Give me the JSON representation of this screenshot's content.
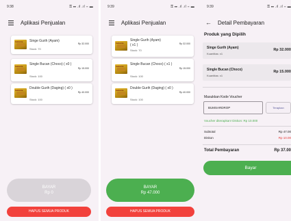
{
  "screens": [
    {
      "status": {
        "time": "9:38",
        "right": "⚿ ☷ .ıl .ıl ⌔ ▬"
      },
      "app_title": "Aplikasi Penjualan",
      "products": [
        {
          "name": "Singe Gurih (Ayam)",
          "qty": "",
          "stock": "Stock: 70",
          "price": "Rp 32.000",
          "brand": "Indomie"
        },
        {
          "name": "Single Bucan (Choco) ( x0 )",
          "qty": "",
          "stock": "Stock: 100",
          "price": "Rp 15.000",
          "brand": "Indomie"
        },
        {
          "name": "Double Gurih (Daging) ( x0 )",
          "qty": "",
          "stock": "Stock: 100",
          "price": "Rp 40.000",
          "brand": "Indomie"
        }
      ],
      "bayar": {
        "label": "BAYAR",
        "amount": "Rp 0",
        "color": "#d9d4d9"
      },
      "hapus_label": "HAPUS SEMUA PRODUK"
    },
    {
      "status": {
        "time": "9:39",
        "right": "⚿ ☷ .ıl .ıl ⌔ ▬"
      },
      "app_title": "Aplikasi Penjualan",
      "products": [
        {
          "name": "Single Gurih (Ayam)",
          "qty": "( x1 )",
          "stock": "Stock: 70",
          "price": "Rp 32.000",
          "brand": "Indomie"
        },
        {
          "name": "Single Bucan (Choco) ( x1 )",
          "qty": "",
          "stock": "Stock: 100",
          "price": "Rp 15.000",
          "brand": "Indomie"
        },
        {
          "name": "Double Gurih (Daging) ( x0 )",
          "qty": "",
          "stock": "Stock: 100",
          "price": "Rp 40.000",
          "brand": "Indomie"
        }
      ],
      "bayar": {
        "label": "BAYAR",
        "amount": "Rp 47.000",
        "color": "#4caf50"
      },
      "hapus_label": "HAPUS SEMUA PRODUK"
    }
  ],
  "detail": {
    "status": {
      "time": "9:39",
      "right": "⚿ ☷ .ıl .ıl ⌔ ▬"
    },
    "title": "Detail Pembayaran",
    "section_title": "Produk yang Dipilih",
    "items": [
      {
        "name": "Singe Gurih (Ayam)",
        "qty": "Kuantitas: x1",
        "price": "Rp 32.000"
      },
      {
        "name": "Single Bucan (Choco)",
        "qty": "Kuantitas: x1",
        "price": "Rp 15.000"
      }
    ],
    "voucher_label": "Masukkan Kode Voucher",
    "voucher_value": "BUMSARDROP",
    "terapkan_label": "Terapkan",
    "applied_text": "Voucher diterapkan! Diskon: Rp 10.000",
    "subtotal_label": "Subtotal",
    "subtotal_value": "Rp 47.00",
    "diskon_label": "Diskon",
    "diskon_value": "Rp 10.00",
    "total_label": "Total Pembayaran",
    "total_value": "Rp 37.00",
    "bayar_label": "Bayar"
  },
  "colors": {
    "accent_green": "#4caf50",
    "danger_red": "#f2413c",
    "discount_red": "#e53935"
  }
}
